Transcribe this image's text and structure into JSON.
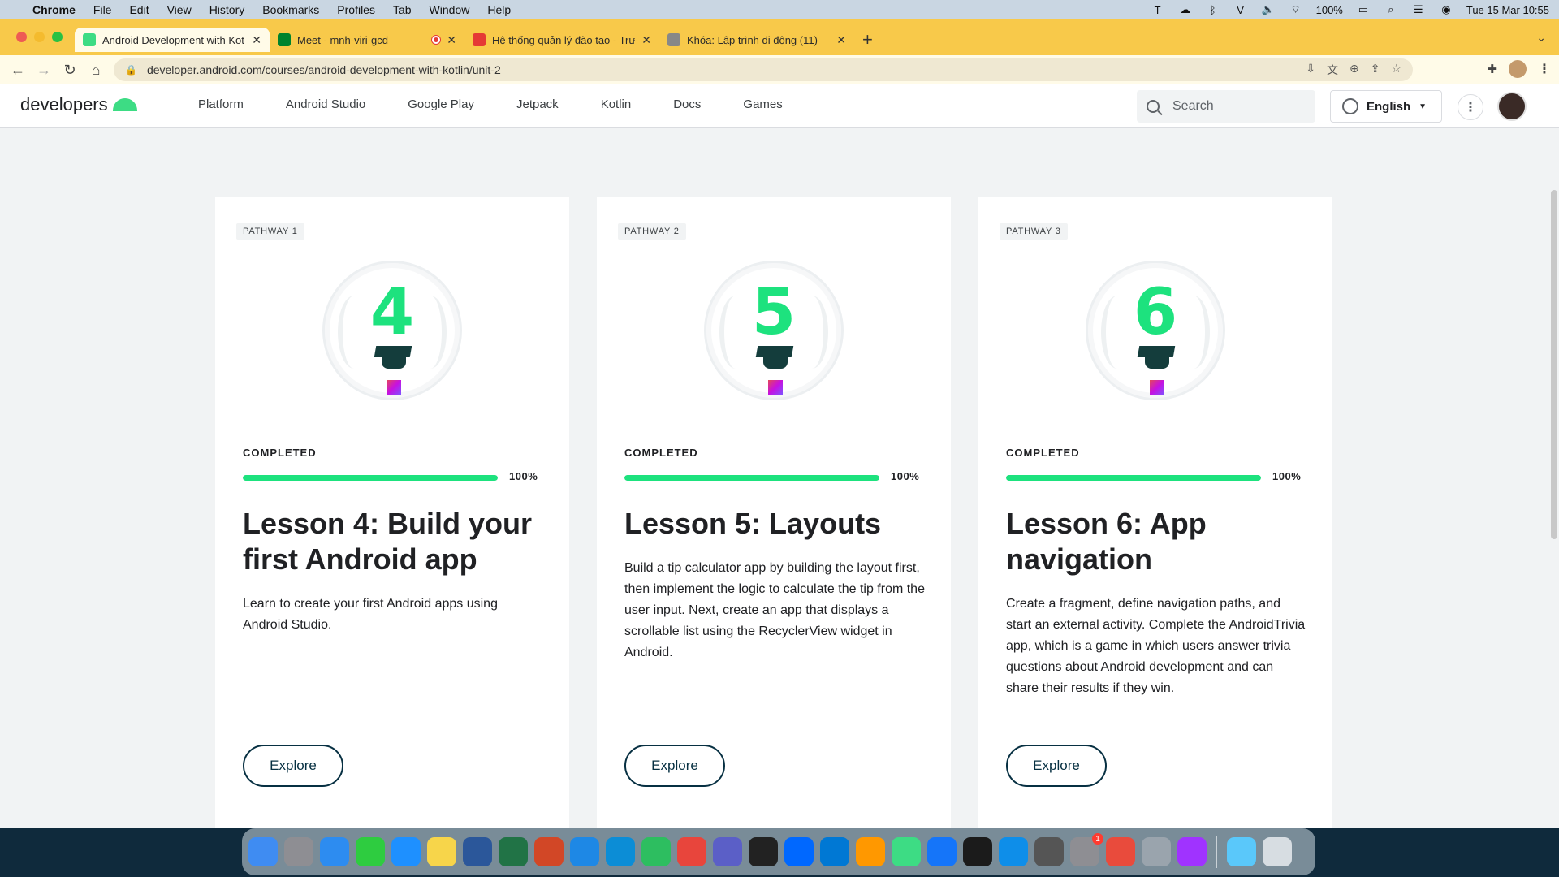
{
  "menubar": {
    "app": "Chrome",
    "items": [
      "File",
      "Edit",
      "View",
      "History",
      "Bookmarks",
      "Profiles",
      "Tab",
      "Window",
      "Help"
    ],
    "battery": "100%",
    "datetime": "Tue 15 Mar  10:55"
  },
  "tabs": [
    {
      "title": "Android Development with Kot",
      "color": "#3ddc84"
    },
    {
      "title": "Meet - mnh-viri-gcd",
      "color": "#00832d"
    },
    {
      "title": "Hệ thống quản lý đào tạo - Trư",
      "color": "#e53935"
    },
    {
      "title": "Khóa: Lập trình di động (11)",
      "color": "#888888"
    }
  ],
  "address": "developer.android.com/courses/android-development-with-kotlin/unit-2",
  "site": {
    "logo": "developers",
    "nav": [
      "Platform",
      "Android Studio",
      "Google Play",
      "Jetpack",
      "Kotlin",
      "Docs",
      "Games"
    ],
    "search_placeholder": "Search",
    "language": "English"
  },
  "cards": [
    {
      "badge": "PATHWAY 1",
      "number": "4",
      "status": "COMPLETED",
      "progress": 100,
      "percent": "100%",
      "title": "Lesson 4: Build your first Android app",
      "description": "Learn to create your first Android apps using Android Studio.",
      "button": "Explore"
    },
    {
      "badge": "PATHWAY 2",
      "number": "5",
      "status": "COMPLETED",
      "progress": 100,
      "percent": "100%",
      "title": "Lesson 5: Layouts",
      "description": "Build a tip calculator app by building the layout first, then implement the logic to calculate the tip from the user input. Next, create an app that displays a scrollable list using the RecyclerView widget in Android.",
      "button": "Explore"
    },
    {
      "badge": "PATHWAY 3",
      "number": "6",
      "status": "COMPLETED",
      "progress": 100,
      "percent": "100%",
      "title": "Lesson 6: App navigation",
      "description": "Create a fragment, define navigation paths, and start an external activity. Complete the AndroidTrivia app, which is a game in which users answer trivia questions about Android development and can share their results if they win.",
      "button": "Explore"
    }
  ],
  "dock": {
    "apps": [
      {
        "name": "finder",
        "color": "#3f8cf2"
      },
      {
        "name": "launchpad",
        "color": "#8e8e93"
      },
      {
        "name": "mail",
        "color": "#2d8cf0"
      },
      {
        "name": "facetime",
        "color": "#2ecc40"
      },
      {
        "name": "app-store",
        "color": "#1e90ff"
      },
      {
        "name": "notes",
        "color": "#f7d54a"
      },
      {
        "name": "word",
        "color": "#2b579a"
      },
      {
        "name": "excel",
        "color": "#217346"
      },
      {
        "name": "powerpoint",
        "color": "#d24726"
      },
      {
        "name": "safari",
        "color": "#1e88e5"
      },
      {
        "name": "edge",
        "color": "#0c8dd6"
      },
      {
        "name": "evernote",
        "color": "#2dbe60"
      },
      {
        "name": "chrome",
        "color": "#e8453c"
      },
      {
        "name": "teams",
        "color": "#5b5fc7"
      },
      {
        "name": "vn-app",
        "color": "#222222"
      },
      {
        "name": "zalo",
        "color": "#0068ff"
      },
      {
        "name": "vscode",
        "color": "#0078d4"
      },
      {
        "name": "sublime",
        "color": "#ff9800"
      },
      {
        "name": "android-studio",
        "color": "#3ddc84"
      },
      {
        "name": "xcode",
        "color": "#1575f9"
      },
      {
        "name": "terminal",
        "color": "#1b1b1b"
      },
      {
        "name": "teamviewer",
        "color": "#0e8ee9"
      },
      {
        "name": "screenshot",
        "color": "#555555"
      },
      {
        "name": "system-preferences",
        "color": "#8e8e93"
      },
      {
        "name": "photo-app",
        "color": "#e94b3c"
      },
      {
        "name": "preview",
        "color": "#9aa4ad"
      },
      {
        "name": "messenger",
        "color": "#a033ff"
      }
    ],
    "badge_count": "1",
    "trash_color": "#d7dde2",
    "folder_color": "#5ac8fa"
  }
}
